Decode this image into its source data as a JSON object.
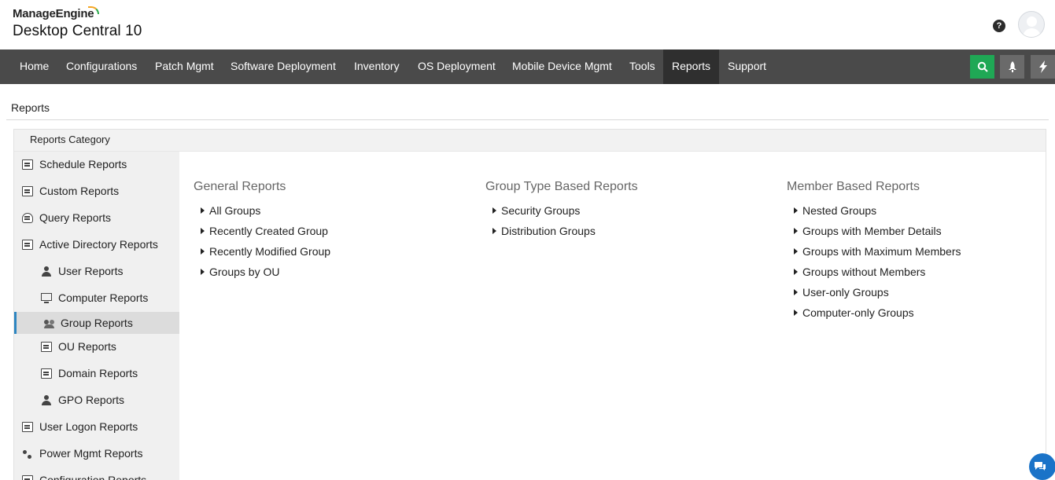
{
  "header": {
    "brand": "ManageEngine",
    "product": "Desktop Central 10",
    "help_icon": "question-circle-icon",
    "avatar_icon": "user-avatar-icon"
  },
  "nav": {
    "items": [
      "Home",
      "Configurations",
      "Patch Mgmt",
      "Software Deployment",
      "Inventory",
      "OS Deployment",
      "Mobile Device Mgmt",
      "Tools",
      "Reports",
      "Support"
    ],
    "active": "Reports",
    "search_icon": "search-icon",
    "rocket_icon": "rocket-icon",
    "bolt_icon": "lightning-bolt-icon",
    "search_color": "#1fa855",
    "bar_color": "#4a4a4a"
  },
  "page": {
    "title": "Reports",
    "category_header": "Reports Category"
  },
  "sidebar": {
    "items": [
      {
        "label": "Schedule Reports",
        "icon": "calendar-report-icon"
      },
      {
        "label": "Custom Reports",
        "icon": "custom-report-icon"
      },
      {
        "label": "Query Reports",
        "icon": "database-icon"
      },
      {
        "label": "Active Directory Reports",
        "icon": "ad-report-icon"
      },
      {
        "label": "User Reports",
        "icon": "user-icon"
      },
      {
        "label": "Computer Reports",
        "icon": "monitor-icon"
      },
      {
        "label": "Group Reports",
        "icon": "group-icon"
      },
      {
        "label": "OU Reports",
        "icon": "ou-search-icon"
      },
      {
        "label": "Domain Reports",
        "icon": "domain-icon"
      },
      {
        "label": "GPO Reports",
        "icon": "gpo-user-icon"
      },
      {
        "label": "User Logon Reports",
        "icon": "logon-report-icon"
      },
      {
        "label": "Power Mgmt Reports",
        "icon": "power-plug-icon"
      },
      {
        "label": "Configuration Reports",
        "icon": "configuration-icon"
      }
    ],
    "selected": "Group Reports",
    "accent": "#2e86c1"
  },
  "columns": [
    {
      "heading": "General Reports",
      "links": [
        "All Groups",
        "Recently Created Group",
        "Recently Modified Group",
        "Groups by OU"
      ]
    },
    {
      "heading": "Group Type Based Reports",
      "links": [
        "Security Groups",
        "Distribution Groups"
      ]
    },
    {
      "heading": "Member Based Reports",
      "links": [
        "Nested Groups",
        "Groups with Member Details",
        "Groups with Maximum Members",
        "Groups without Members",
        "User-only Groups",
        "Computer-only Groups"
      ]
    }
  ],
  "chat_icon": "chat-bubble-icon"
}
